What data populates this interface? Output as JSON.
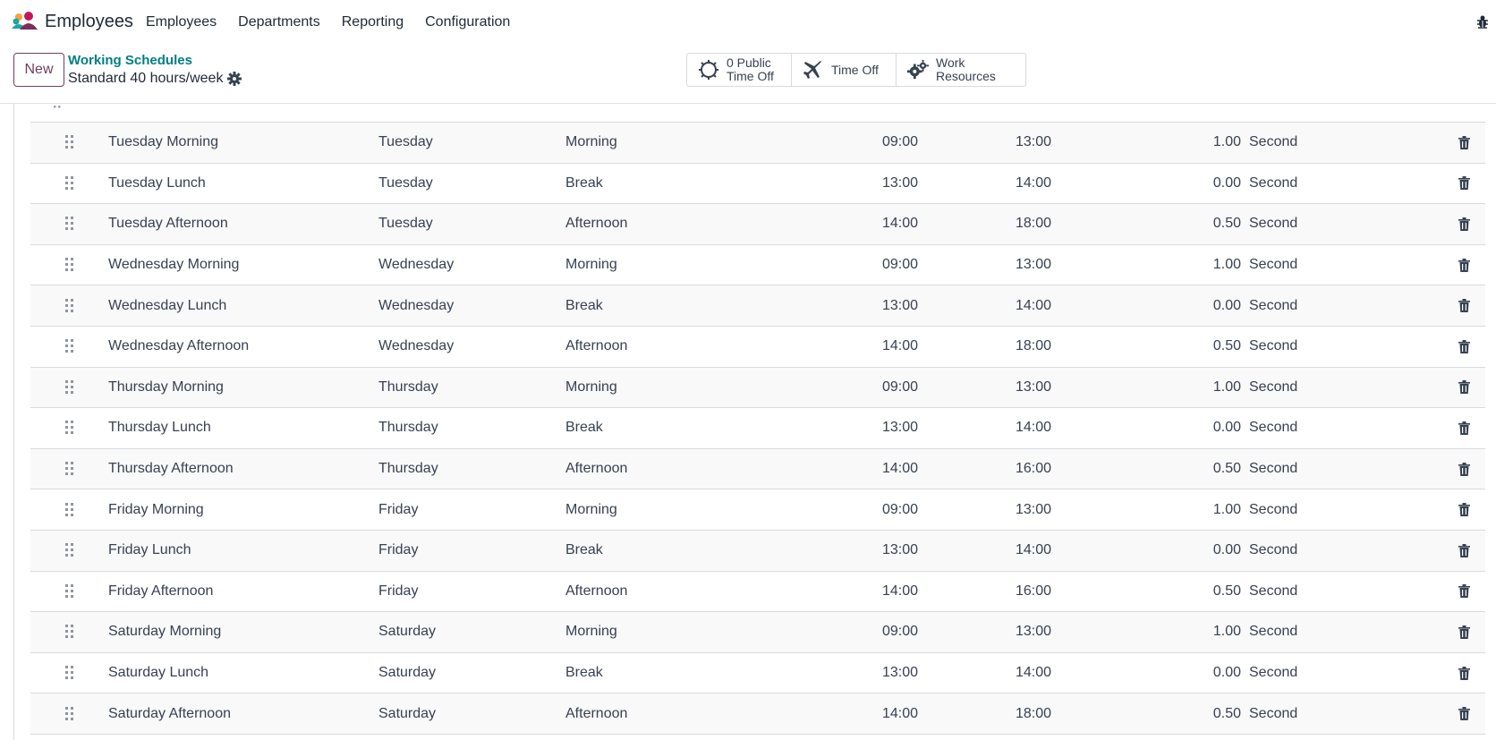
{
  "nav": {
    "app_name": "Employees",
    "menu": [
      "Employees",
      "Departments",
      "Reporting",
      "Configuration"
    ],
    "accent_color": "#71405f"
  },
  "control_panel": {
    "new_label": "New",
    "breadcrumb": "Working Schedules",
    "record_title": "Standard 40 hours/week",
    "smart_buttons": [
      {
        "icon": "public-time-off-icon",
        "line1": "0 Public",
        "line2": "Time Off"
      },
      {
        "icon": "plane-icon",
        "line1": "Time Off",
        "line2": ""
      },
      {
        "icon": "gears-icon",
        "line1": "Work Resources",
        "line2": ""
      }
    ]
  },
  "attendances": {
    "rows": [
      {
        "name": "Tuesday Morning",
        "day": "Tuesday",
        "period": "Morning",
        "from": "09:00",
        "to": "13:00",
        "duration": "1.00",
        "week": "Second"
      },
      {
        "name": "Tuesday Lunch",
        "day": "Tuesday",
        "period": "Break",
        "from": "13:00",
        "to": "14:00",
        "duration": "0.00",
        "week": "Second"
      },
      {
        "name": "Tuesday Afternoon",
        "day": "Tuesday",
        "period": "Afternoon",
        "from": "14:00",
        "to": "18:00",
        "duration": "0.50",
        "week": "Second"
      },
      {
        "name": "Wednesday Morning",
        "day": "Wednesday",
        "period": "Morning",
        "from": "09:00",
        "to": "13:00",
        "duration": "1.00",
        "week": "Second"
      },
      {
        "name": "Wednesday Lunch",
        "day": "Wednesday",
        "period": "Break",
        "from": "13:00",
        "to": "14:00",
        "duration": "0.00",
        "week": "Second"
      },
      {
        "name": "Wednesday Afternoon",
        "day": "Wednesday",
        "period": "Afternoon",
        "from": "14:00",
        "to": "18:00",
        "duration": "0.50",
        "week": "Second"
      },
      {
        "name": "Thursday Morning",
        "day": "Thursday",
        "period": "Morning",
        "from": "09:00",
        "to": "13:00",
        "duration": "1.00",
        "week": "Second"
      },
      {
        "name": "Thursday Lunch",
        "day": "Thursday",
        "period": "Break",
        "from": "13:00",
        "to": "14:00",
        "duration": "0.00",
        "week": "Second"
      },
      {
        "name": "Thursday Afternoon",
        "day": "Thursday",
        "period": "Afternoon",
        "from": "14:00",
        "to": "16:00",
        "duration": "0.50",
        "week": "Second"
      },
      {
        "name": "Friday Morning",
        "day": "Friday",
        "period": "Morning",
        "from": "09:00",
        "to": "13:00",
        "duration": "1.00",
        "week": "Second"
      },
      {
        "name": "Friday Lunch",
        "day": "Friday",
        "period": "Break",
        "from": "13:00",
        "to": "14:00",
        "duration": "0.00",
        "week": "Second"
      },
      {
        "name": "Friday Afternoon",
        "day": "Friday",
        "period": "Afternoon",
        "from": "14:00",
        "to": "16:00",
        "duration": "0.50",
        "week": "Second"
      },
      {
        "name": "Saturday Morning",
        "day": "Saturday",
        "period": "Morning",
        "from": "09:00",
        "to": "13:00",
        "duration": "1.00",
        "week": "Second"
      },
      {
        "name": "Saturday Lunch",
        "day": "Saturday",
        "period": "Break",
        "from": "13:00",
        "to": "14:00",
        "duration": "0.00",
        "week": "Second"
      },
      {
        "name": "Saturday Afternoon",
        "day": "Saturday",
        "period": "Afternoon",
        "from": "14:00",
        "to": "18:00",
        "duration": "0.50",
        "week": "Second"
      }
    ]
  }
}
